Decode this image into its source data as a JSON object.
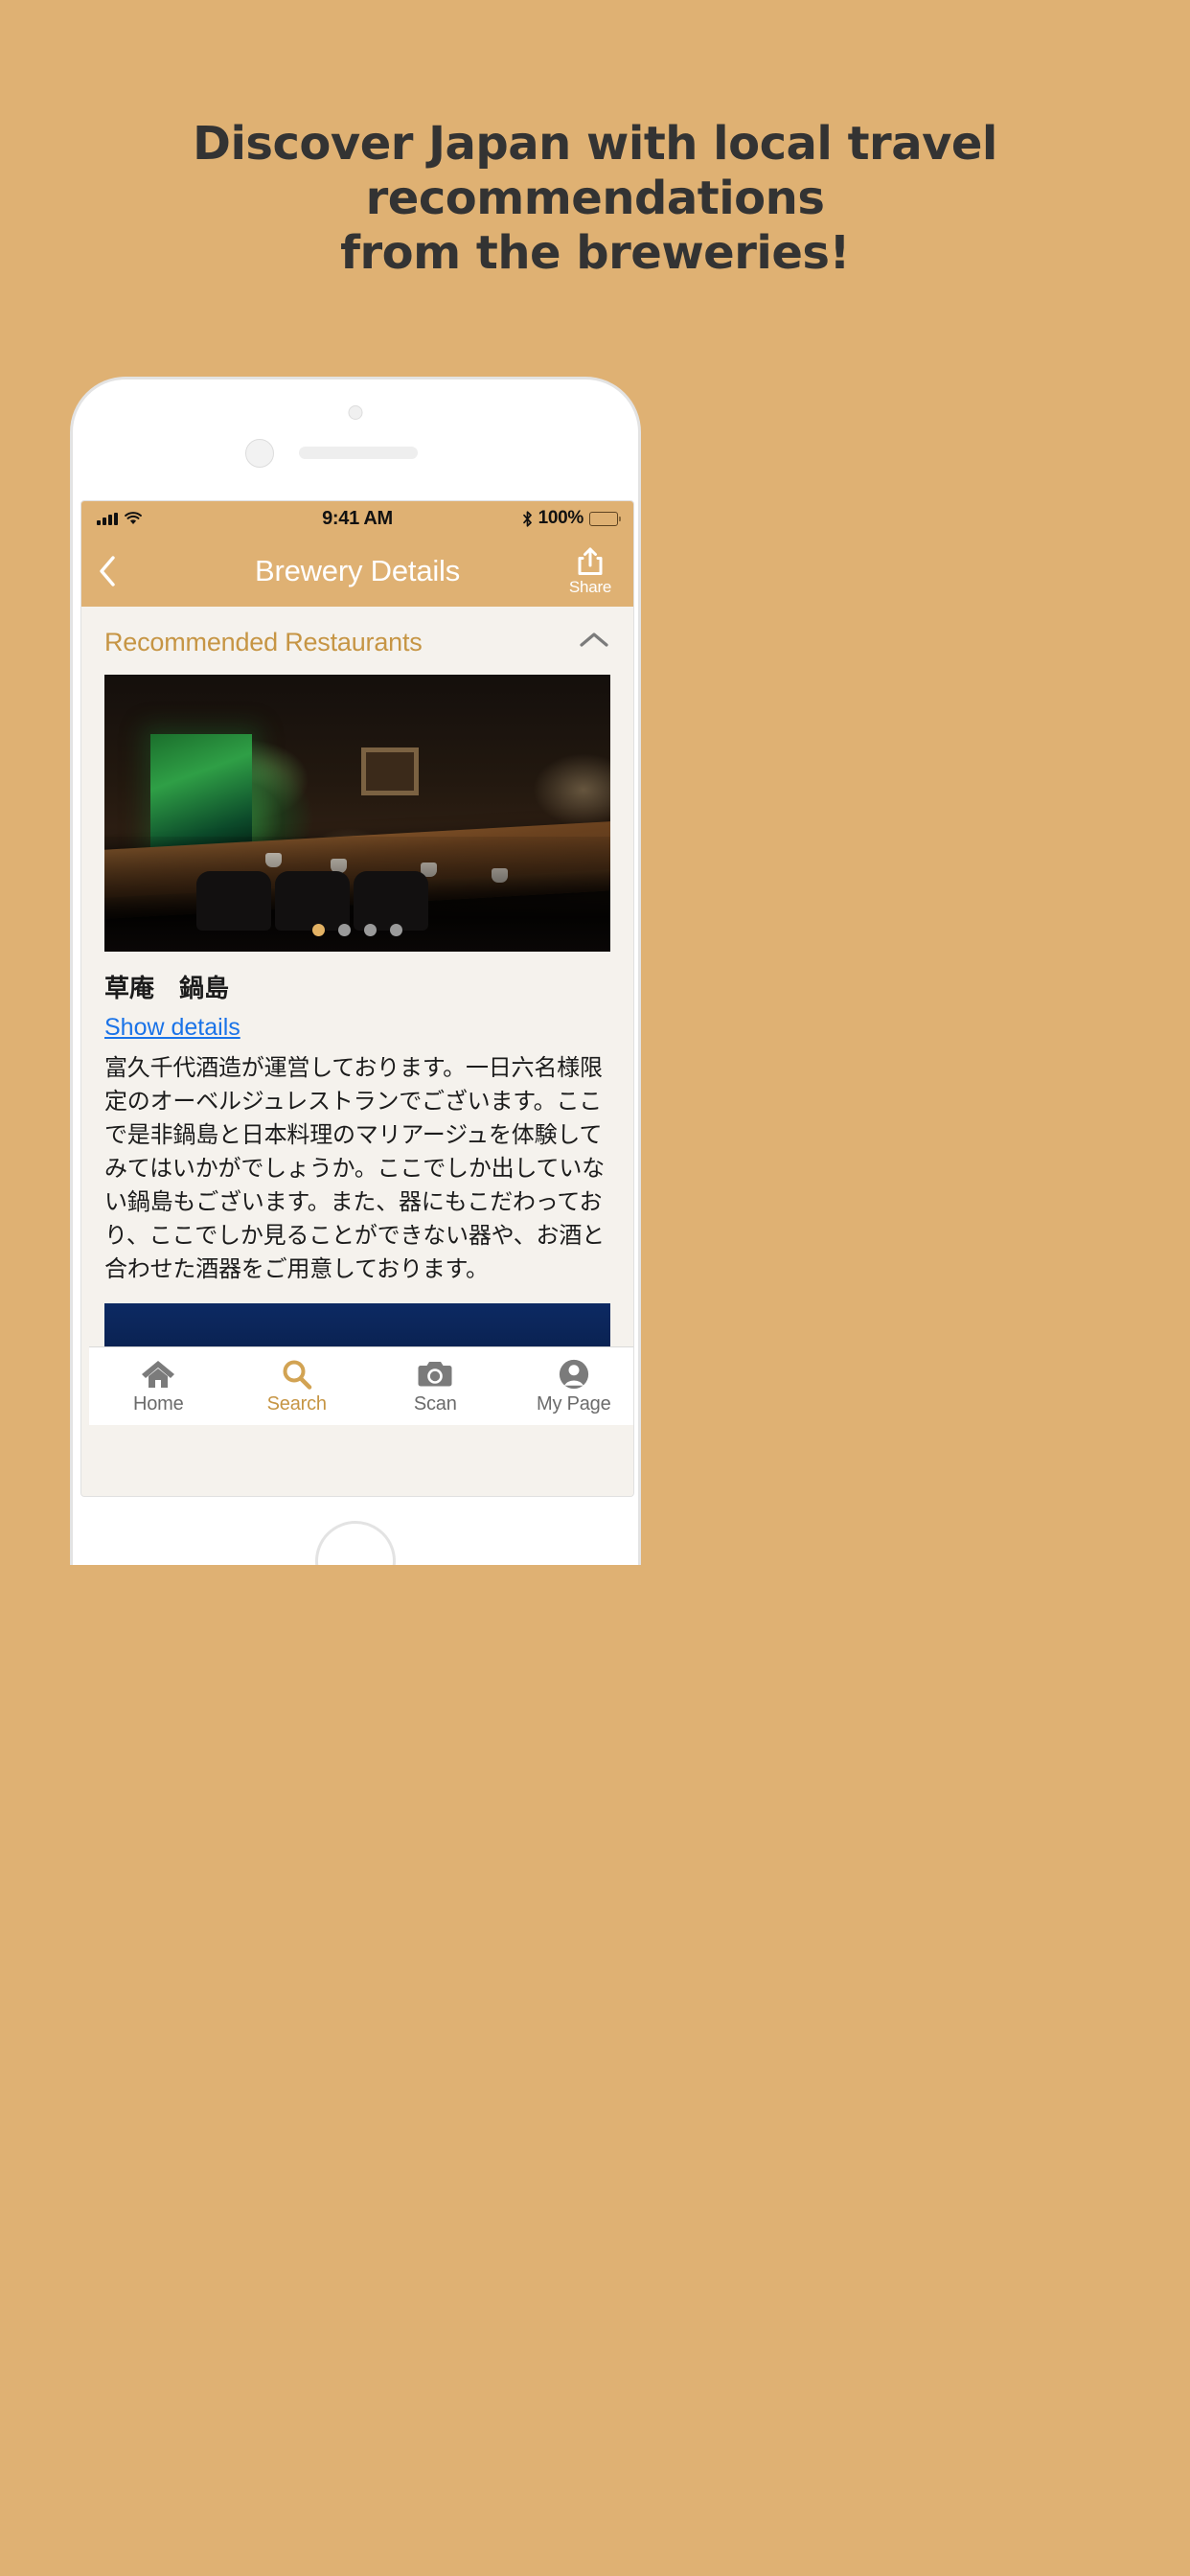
{
  "promo": {
    "background_color": "#dfb173",
    "headline_lines": [
      "Discover Japan with local travel",
      "recommendations",
      "from the breweries!"
    ]
  },
  "status_bar": {
    "time": "9:41 AM",
    "battery_percent": "100%",
    "signal_icon": "cellular-signal-icon",
    "wifi_icon": "wifi-icon",
    "bluetooth_icon": "bluetooth-icon",
    "battery_icon": "battery-full-icon"
  },
  "nav_bar": {
    "back_icon": "chevron-left-icon",
    "title": "Brewery Details",
    "share_icon": "share-upload-icon",
    "share_label": "Share",
    "background_color": "#dfb173",
    "title_color": "#ffffff"
  },
  "section": {
    "title": "Recommended Restaurants",
    "title_color": "#c69544",
    "collapse_icon": "chevron-up-icon",
    "expanded": true
  },
  "carousel": {
    "image_alt": "restaurant-interior-counter-seating",
    "dot_count": 4,
    "active_dot_index": 0,
    "active_dot_color": "#e3b264",
    "inactive_dot_color": "#9a9a9a"
  },
  "restaurant": {
    "name": "草庵　鍋島",
    "details_link_label": "Show details",
    "details_link_color": "#1a73e8",
    "description": "富久千代酒造が運営しております。一日六名様限定のオーベルジュレストランでございます。ここで是非鍋島と日本料理のマリアージュを体験してみてはいかがでしょうか。ここでしか出していない鍋島もございます。また、器にもこだわっており、ここでしか見ることができない器や、お酒と合わせた酒器をご用意しております。"
  },
  "banner": {
    "color": "#0d2a63"
  },
  "tab_bar": {
    "active_color": "#c69544",
    "inactive_color": "#6b6b6b",
    "items": [
      {
        "label": "Home",
        "icon": "home-icon",
        "active": false
      },
      {
        "label": "Search",
        "icon": "search-icon",
        "active": true
      },
      {
        "label": "Scan",
        "icon": "camera-scan-icon",
        "active": false
      },
      {
        "label": "My Page",
        "icon": "user-account-icon",
        "active": false
      }
    ]
  }
}
